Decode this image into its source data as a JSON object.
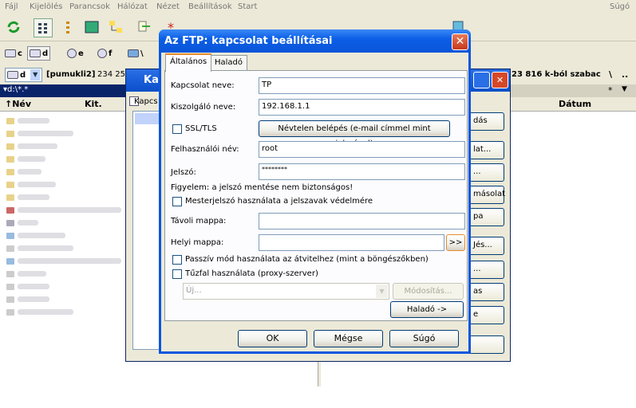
{
  "menu": [
    "Fájl",
    "Kijelölés",
    "Parancsok",
    "Hálózat",
    "Nézet",
    "Beállítások",
    "Start"
  ],
  "menu_help": "Súgó",
  "drives_top": [
    "c",
    "d",
    "e",
    "f",
    "\\"
  ],
  "left_drive": "d",
  "left_label": "[pumukli2]",
  "left_free": "234 25",
  "right_free": "23 816 k-ból szabac",
  "right_root": "\\",
  "right_up": "..",
  "path_filter": "d:\\*.*",
  "right_filter": "*",
  "columns": {
    "name": "Név",
    "ext": "Kit.",
    "date": "Dátum"
  },
  "bg_dialog": {
    "title": "Ka",
    "label": "Kapcs",
    "buttons": [
      "dás",
      "lat...",
      "...",
      "másolat",
      "pa",
      "Jés...",
      "...",
      "as",
      "e"
    ]
  },
  "dialog": {
    "title": "Az FTP: kapcsolat beállításai",
    "tabs": [
      "Általános",
      "Haladó"
    ],
    "connection_name_label": "Kapcsolat neve:",
    "connection_name": "TP",
    "host_label": "Kiszolgáló neve:",
    "host": "192.168.1.1",
    "ssl_label": "SSL/TLS",
    "anon_button": "Névtelen belépés (e-mail címmel mint jelszóval)",
    "user_label": "Felhasználói név:",
    "user": "root",
    "password_label": "Jelszó:",
    "password": "********",
    "warning": "Figyelem: a jelszó mentése nem biztonságos!",
    "master_label": "Mesterjelszó használata a jelszavak védelmére",
    "remote_label": "Távoli mappa:",
    "remote": "",
    "local_label": "Helyi mappa:",
    "local": "",
    "browse": ">>",
    "passive_label": "Passzív mód használata az átvitelhez (mint a böngészőkben)",
    "firewall_label": "Tűzfal használata (proxy-szerver)",
    "proxy_placeholder": "Új...",
    "modify": "Módosítás...",
    "advanced": "Haladó ->",
    "ok": "OK",
    "cancel": "Mégse",
    "help": "Súgó"
  }
}
